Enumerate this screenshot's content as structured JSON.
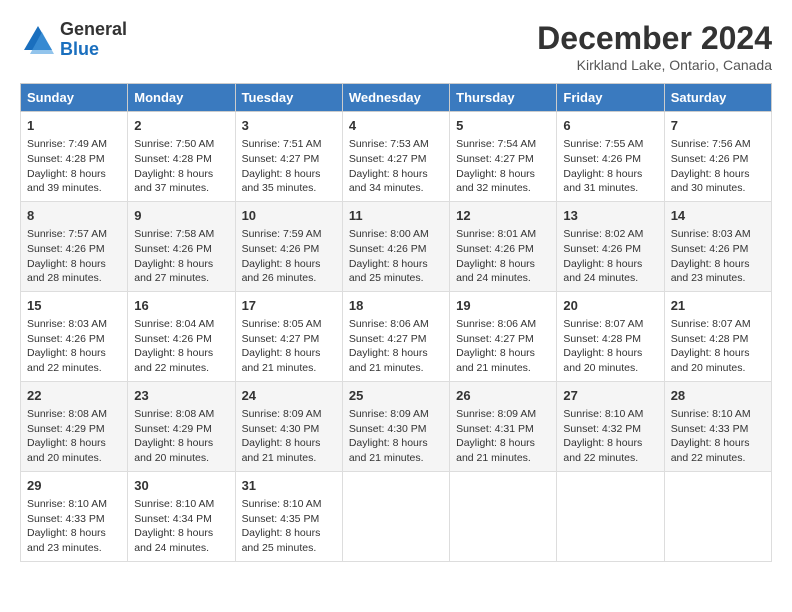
{
  "header": {
    "logo_general": "General",
    "logo_blue": "Blue",
    "month_title": "December 2024",
    "location": "Kirkland Lake, Ontario, Canada"
  },
  "days_of_week": [
    "Sunday",
    "Monday",
    "Tuesday",
    "Wednesday",
    "Thursday",
    "Friday",
    "Saturday"
  ],
  "weeks": [
    [
      {
        "day": 1,
        "sunrise": "7:49 AM",
        "sunset": "4:28 PM",
        "daylight": "8 hours and 39 minutes."
      },
      {
        "day": 2,
        "sunrise": "7:50 AM",
        "sunset": "4:28 PM",
        "daylight": "8 hours and 37 minutes."
      },
      {
        "day": 3,
        "sunrise": "7:51 AM",
        "sunset": "4:27 PM",
        "daylight": "8 hours and 35 minutes."
      },
      {
        "day": 4,
        "sunrise": "7:53 AM",
        "sunset": "4:27 PM",
        "daylight": "8 hours and 34 minutes."
      },
      {
        "day": 5,
        "sunrise": "7:54 AM",
        "sunset": "4:27 PM",
        "daylight": "8 hours and 32 minutes."
      },
      {
        "day": 6,
        "sunrise": "7:55 AM",
        "sunset": "4:26 PM",
        "daylight": "8 hours and 31 minutes."
      },
      {
        "day": 7,
        "sunrise": "7:56 AM",
        "sunset": "4:26 PM",
        "daylight": "8 hours and 30 minutes."
      }
    ],
    [
      {
        "day": 8,
        "sunrise": "7:57 AM",
        "sunset": "4:26 PM",
        "daylight": "8 hours and 28 minutes."
      },
      {
        "day": 9,
        "sunrise": "7:58 AM",
        "sunset": "4:26 PM",
        "daylight": "8 hours and 27 minutes."
      },
      {
        "day": 10,
        "sunrise": "7:59 AM",
        "sunset": "4:26 PM",
        "daylight": "8 hours and 26 minutes."
      },
      {
        "day": 11,
        "sunrise": "8:00 AM",
        "sunset": "4:26 PM",
        "daylight": "8 hours and 25 minutes."
      },
      {
        "day": 12,
        "sunrise": "8:01 AM",
        "sunset": "4:26 PM",
        "daylight": "8 hours and 24 minutes."
      },
      {
        "day": 13,
        "sunrise": "8:02 AM",
        "sunset": "4:26 PM",
        "daylight": "8 hours and 24 minutes."
      },
      {
        "day": 14,
        "sunrise": "8:03 AM",
        "sunset": "4:26 PM",
        "daylight": "8 hours and 23 minutes."
      }
    ],
    [
      {
        "day": 15,
        "sunrise": "8:03 AM",
        "sunset": "4:26 PM",
        "daylight": "8 hours and 22 minutes."
      },
      {
        "day": 16,
        "sunrise": "8:04 AM",
        "sunset": "4:26 PM",
        "daylight": "8 hours and 22 minutes."
      },
      {
        "day": 17,
        "sunrise": "8:05 AM",
        "sunset": "4:27 PM",
        "daylight": "8 hours and 21 minutes."
      },
      {
        "day": 18,
        "sunrise": "8:06 AM",
        "sunset": "4:27 PM",
        "daylight": "8 hours and 21 minutes."
      },
      {
        "day": 19,
        "sunrise": "8:06 AM",
        "sunset": "4:27 PM",
        "daylight": "8 hours and 21 minutes."
      },
      {
        "day": 20,
        "sunrise": "8:07 AM",
        "sunset": "4:28 PM",
        "daylight": "8 hours and 20 minutes."
      },
      {
        "day": 21,
        "sunrise": "8:07 AM",
        "sunset": "4:28 PM",
        "daylight": "8 hours and 20 minutes."
      }
    ],
    [
      {
        "day": 22,
        "sunrise": "8:08 AM",
        "sunset": "4:29 PM",
        "daylight": "8 hours and 20 minutes."
      },
      {
        "day": 23,
        "sunrise": "8:08 AM",
        "sunset": "4:29 PM",
        "daylight": "8 hours and 20 minutes."
      },
      {
        "day": 24,
        "sunrise": "8:09 AM",
        "sunset": "4:30 PM",
        "daylight": "8 hours and 21 minutes."
      },
      {
        "day": 25,
        "sunrise": "8:09 AM",
        "sunset": "4:30 PM",
        "daylight": "8 hours and 21 minutes."
      },
      {
        "day": 26,
        "sunrise": "8:09 AM",
        "sunset": "4:31 PM",
        "daylight": "8 hours and 21 minutes."
      },
      {
        "day": 27,
        "sunrise": "8:10 AM",
        "sunset": "4:32 PM",
        "daylight": "8 hours and 22 minutes."
      },
      {
        "day": 28,
        "sunrise": "8:10 AM",
        "sunset": "4:33 PM",
        "daylight": "8 hours and 22 minutes."
      }
    ],
    [
      {
        "day": 29,
        "sunrise": "8:10 AM",
        "sunset": "4:33 PM",
        "daylight": "8 hours and 23 minutes."
      },
      {
        "day": 30,
        "sunrise": "8:10 AM",
        "sunset": "4:34 PM",
        "daylight": "8 hours and 24 minutes."
      },
      {
        "day": 31,
        "sunrise": "8:10 AM",
        "sunset": "4:35 PM",
        "daylight": "8 hours and 25 minutes."
      },
      null,
      null,
      null,
      null
    ]
  ]
}
